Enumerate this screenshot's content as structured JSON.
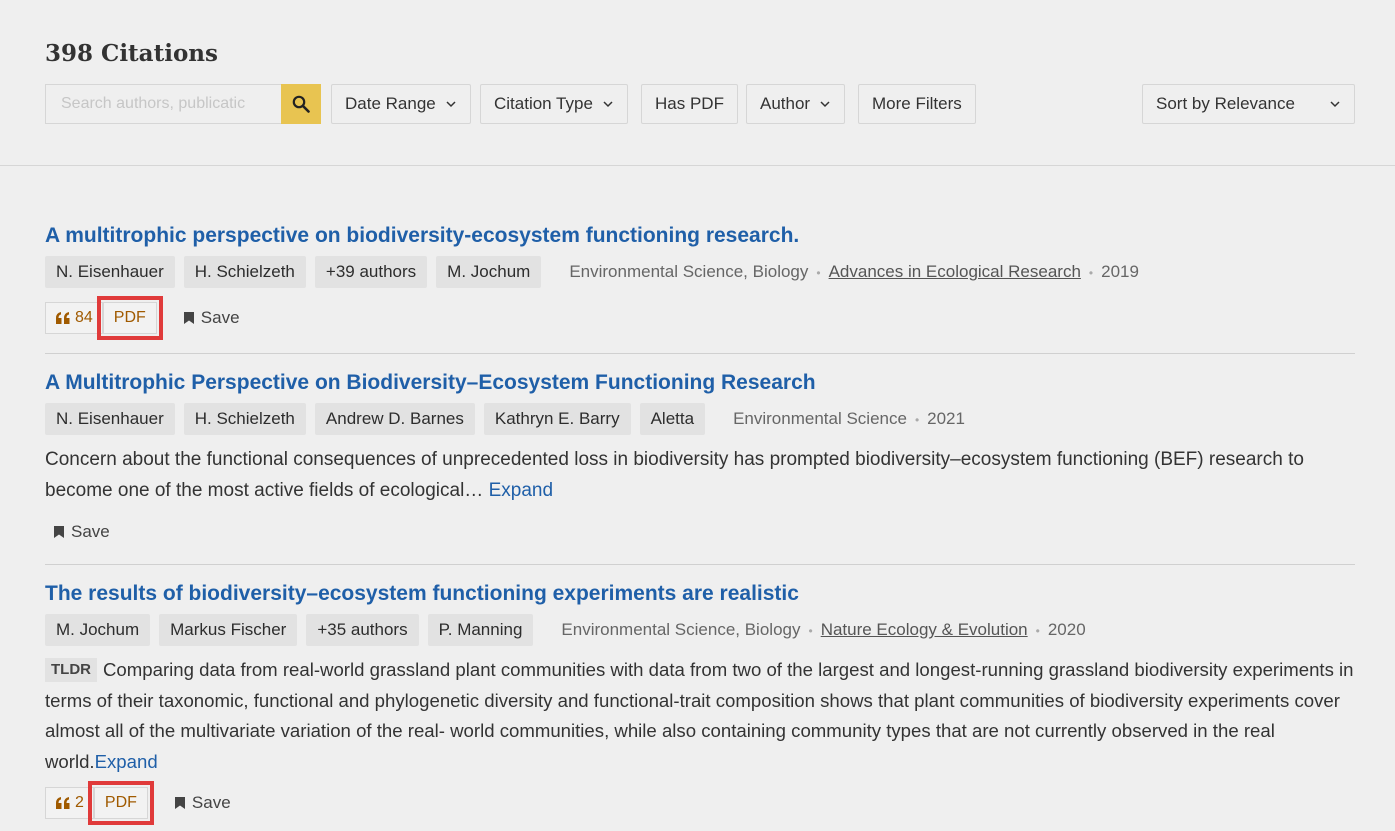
{
  "header": {
    "title": "398 Citations",
    "search": {
      "placeholder": "Search authors, publicatic",
      "value": ""
    },
    "filters": [
      "Date Range",
      "Citation Type",
      "Has PDF",
      "Author",
      "More Filters"
    ],
    "sort_label": "Sort by Relevance"
  },
  "colors": {
    "link": "#1f5fa8",
    "accent": "#e8c451",
    "highlight": "#e03a3a",
    "citation": "#a05a00"
  },
  "results": [
    {
      "title": "A multitrophic perspective on biodiversity-ecosystem functioning research.",
      "authors": [
        "N. Eisenhauer",
        "H. Schielzeth",
        "+39 authors",
        "M. Jochum"
      ],
      "fields": "Environmental Science, Biology",
      "venue": "Advances in Ecological Research",
      "year": "2019",
      "citations": "84",
      "pdf_label": "PDF",
      "save_label": "Save"
    },
    {
      "title": "A Multitrophic Perspective on Biodiversity–Ecosystem Functioning Research",
      "authors": [
        "N. Eisenhauer",
        "H. Schielzeth",
        "Andrew D. Barnes",
        "Kathryn E. Barry",
        "Aletta"
      ],
      "fields": "Environmental Science",
      "year": "2021",
      "abstract": "Concern about the functional consequences of unprecedented loss in biodiversity has prompted biodiversity–ecosystem functioning (BEF) research to become one of the most active fields of ecological…",
      "expand_label": "Expand",
      "save_label": "Save"
    },
    {
      "title": "The results of biodiversity–ecosystem functioning experiments are realistic",
      "authors": [
        "M. Jochum",
        "Markus Fischer",
        "+35 authors",
        "P. Manning"
      ],
      "fields": "Environmental Science, Biology",
      "venue": "Nature Ecology & Evolution",
      "year": "2020",
      "tldr_label": "TLDR",
      "abstract": "Comparing data from real-world grassland plant communities with data from two of the largest and longest-running grassland biodiversity experiments in terms of their taxonomic, functional and phylogenetic diversity and functional-trait composition shows that plant communities of biodiversity experiments cover almost all of the multivariate variation of the real- world communities, while also containing community types that are not currently observed in the real world.",
      "expand_label": "Expand",
      "citations": "2",
      "pdf_label": "PDF",
      "save_label": "Save"
    }
  ]
}
